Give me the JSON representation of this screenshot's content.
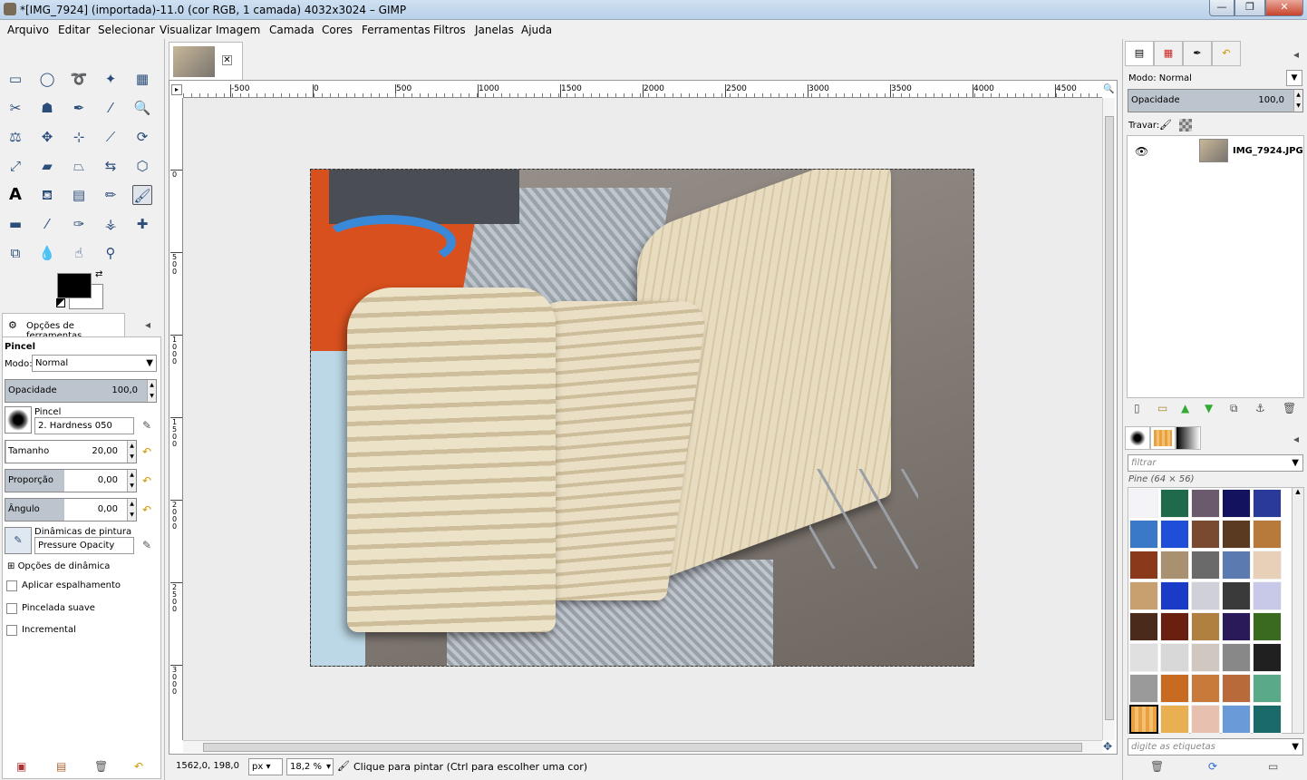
{
  "window": {
    "title": "*[IMG_7924] (importada)-11.0 (cor RGB, 1 camada) 4032x3024 – GIMP",
    "minimize": "—",
    "maximize": "❐",
    "close": "✕"
  },
  "menu": [
    "Arquivo",
    "Editar",
    "Selecionar",
    "Visualizar",
    "Imagem",
    "Camada",
    "Cores",
    "Ferramentas",
    "Filtros",
    "Janelas",
    "Ajuda"
  ],
  "toolbox": {
    "tools": [
      {
        "icon": "rect-select-icon",
        "glyph": "▭"
      },
      {
        "icon": "ellipse-select-icon",
        "glyph": "◯"
      },
      {
        "icon": "free-select-icon",
        "glyph": "➰"
      },
      {
        "icon": "fuzzy-select-icon",
        "glyph": "✦"
      },
      {
        "icon": "select-by-color-icon",
        "glyph": "▦"
      },
      {
        "icon": "scissors-select-icon",
        "glyph": "✂"
      },
      {
        "icon": "foreground-select-icon",
        "glyph": "☗"
      },
      {
        "icon": "paths-icon",
        "glyph": "✒"
      },
      {
        "icon": "color-picker-icon",
        "glyph": "⁄"
      },
      {
        "icon": "zoom-icon",
        "glyph": "🔍"
      },
      {
        "icon": "measure-icon",
        "glyph": "⚖"
      },
      {
        "icon": "move-icon",
        "glyph": "✥"
      },
      {
        "icon": "align-icon",
        "glyph": "⊹"
      },
      {
        "icon": "crop-icon",
        "glyph": "⟋"
      },
      {
        "icon": "rotate-icon",
        "glyph": "⟳"
      },
      {
        "icon": "scale-icon",
        "glyph": "⤢"
      },
      {
        "icon": "shear-icon",
        "glyph": "▰"
      },
      {
        "icon": "perspective-icon",
        "glyph": "⏢"
      },
      {
        "icon": "flip-icon",
        "glyph": "⇆"
      },
      {
        "icon": "cage-transform-icon",
        "glyph": "⬡"
      },
      {
        "icon": "text-icon",
        "glyph": "A"
      },
      {
        "icon": "bucket-fill-icon",
        "glyph": "⛾"
      },
      {
        "icon": "blend-icon",
        "glyph": "▤"
      },
      {
        "icon": "pencil-icon",
        "glyph": "✏"
      },
      {
        "icon": "paintbrush-icon",
        "glyph": "🖌"
      },
      {
        "icon": "eraser-icon",
        "glyph": "▬"
      },
      {
        "icon": "airbrush-icon",
        "glyph": "⁄"
      },
      {
        "icon": "ink-icon",
        "glyph": "✑"
      },
      {
        "icon": "clone-icon",
        "glyph": "⚶"
      },
      {
        "icon": "heal-icon",
        "glyph": "✚"
      },
      {
        "icon": "perspective-clone-icon",
        "glyph": "⧉"
      },
      {
        "icon": "blur-icon",
        "glyph": "💧"
      },
      {
        "icon": "smudge-icon",
        "glyph": "☝"
      },
      {
        "icon": "dodge-burn-icon",
        "glyph": "⚲"
      }
    ],
    "fg_color": "#000000",
    "bg_color": "#ffffff"
  },
  "tool_options": {
    "tab_label": "Opções de ferramentas",
    "tool_name": "Pincel",
    "mode_label": "Modo:",
    "mode_value": "Normal",
    "opacity_label": "Opacidade",
    "opacity_value": "100,0",
    "brush_label": "Pincel",
    "brush_value": "2. Hardness 050",
    "size_label": "Tamanho",
    "size_value": "20,00",
    "ratio_label": "Proporção",
    "ratio_value": "0,00",
    "angle_label": "Ângulo",
    "angle_value": "0,00",
    "dynamics_label": "Dinâmicas de pintura",
    "dynamics_value": "Pressure Opacity",
    "dynamics_options": "Opções de dinâmica",
    "apply_jitter": "Aplicar espalhamento",
    "smooth_stroke": "Pincelada suave",
    "incremental": "Incremental"
  },
  "ruler": {
    "h_labels": [
      "-500",
      "0",
      "500",
      "1000",
      "1500",
      "2000",
      "2500",
      "3000",
      "3500",
      "4000",
      "4500"
    ],
    "v_labels": [
      "0",
      "500",
      "1000",
      "1500",
      "2000",
      "2500",
      "3000"
    ]
  },
  "status": {
    "coords": "1562,0, 198,0",
    "unit": "px",
    "zoom": "18,2 %",
    "message": "Clique para pintar (Ctrl para escolher uma cor)"
  },
  "layers": {
    "mode_label": "Modo:",
    "mode_value": "Normal",
    "opacity_label": "Opacidade",
    "opacity_value": "100,0",
    "lock_label": "Travar:",
    "layer_name": "IMG_7924.JPG"
  },
  "patterns": {
    "filter_placeholder": "filtrar",
    "selected_label": "Pine (64 × 56)",
    "tags_placeholder": "digite as etiquetas",
    "swatches": [
      "#f4f4f8",
      "#1e6a4a",
      "#6b5a6e",
      "#12125e",
      "#2a3a9a",
      "#3a78c8",
      "#1f4fd8",
      "#7a4a30",
      "#5a3a20",
      "#b87a3a",
      "#8a3a1a",
      "#a89070",
      "#6a6a6a",
      "#5a7ab0",
      "#e8d0b8",
      "#c8a070",
      "#1a3ac8",
      "#d0d0d8",
      "#3a3a3a",
      "#c8c8e8",
      "#4a2a1a",
      "#6a2010",
      "#b08040",
      "#2a1a5a",
      "#3a6a20",
      "#e0e0e0",
      "#d8d8d8",
      "#d0c8c0",
      "#888888",
      "#202020",
      "#9a9a9a",
      "#c86a20",
      "#c87a3a",
      "#b86a3a",
      "#5aaa8a",
      "#e8a040",
      "#e8b050",
      "#e8c0b0",
      "#6a9ad8",
      "#1a6a6a"
    ]
  }
}
